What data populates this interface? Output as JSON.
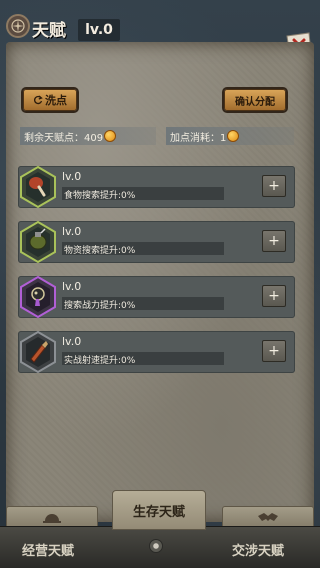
{
  "header": {
    "title": "天赋",
    "level": "lv.0",
    "emblem_icon": "compass-emblem-icon",
    "close_icon": "close-x-icon"
  },
  "toolbar": {
    "wash_label": "洗点",
    "wash_icon": "refresh-icon",
    "confirm_label": "确认分配"
  },
  "points": {
    "remaining_label": "剩余天赋点：409",
    "cost_label": "加点消耗：1",
    "currency_icon": "gold-coin-icon"
  },
  "skills": [
    {
      "level": "lv.0",
      "desc": "食物搜索提升:0%",
      "icon": "drumstick-icon",
      "color": "#a9c25a"
    },
    {
      "level": "lv.0",
      "desc": "物资搜索提升:0%",
      "icon": "grenade-icon",
      "color": "#a9c25a"
    },
    {
      "level": "lv.0",
      "desc": "搜索战力提升:0%",
      "icon": "gas-mask-icon",
      "color": "#b15fd6"
    },
    {
      "level": "lv.0",
      "desc": "实战射速提升:0%",
      "icon": "bullet-icon",
      "color": "#8c9094"
    }
  ],
  "plus_label": "+",
  "tabs": {
    "center_label": "生存天赋",
    "left_label": "经营天赋",
    "right_label": "交涉天赋",
    "left_icon": "helmet-icon",
    "right_icon": "handshake-icon"
  }
}
